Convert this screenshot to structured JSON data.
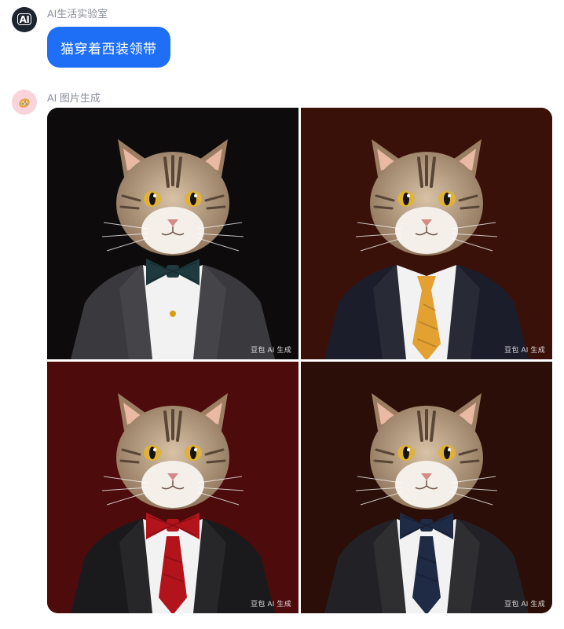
{
  "messages": [
    {
      "sender": "AI生活实验室",
      "avatar_icon": "ai-lab-logo-icon",
      "avatar_mark": "AI",
      "avatar_color": "#1c2430",
      "text": "猫穿着西装领带",
      "bubble_color": "#1e6ff5"
    },
    {
      "sender": "AI 图片生成",
      "avatar_icon": "image-generator-icon",
      "avatar_color": "#f9d4db",
      "images": [
        {
          "subject": "cat-in-suit-teal-bow-tie",
          "background_color": "#0d0b0b",
          "suit_color": "#3a393d",
          "tie_style": "bow-tie",
          "tie_color": "#1e3a3f",
          "watermark": "豆包 AI 生成"
        },
        {
          "subject": "cat-in-suit-gold-necktie",
          "background_color": "#3a1109",
          "suit_color": "#1b1d2a",
          "tie_style": "necktie",
          "tie_color": "#e3a131",
          "watermark": "豆包 AI 生成"
        },
        {
          "subject": "cat-in-suit-red-bow-tie",
          "background_color": "#4d0b0c",
          "suit_color": "#1a1a1d",
          "tie_style": "bow-tie-with-necktie",
          "tie_color": "#b3141c",
          "watermark": "豆包 AI 生成"
        },
        {
          "subject": "cat-in-suit-navy-bow-tie",
          "background_color": "#2a0e07",
          "suit_color": "#222226",
          "tie_style": "bow-tie-with-necktie",
          "tie_color": "#1f2a44",
          "watermark": "豆包 AI 生成"
        }
      ]
    }
  ]
}
